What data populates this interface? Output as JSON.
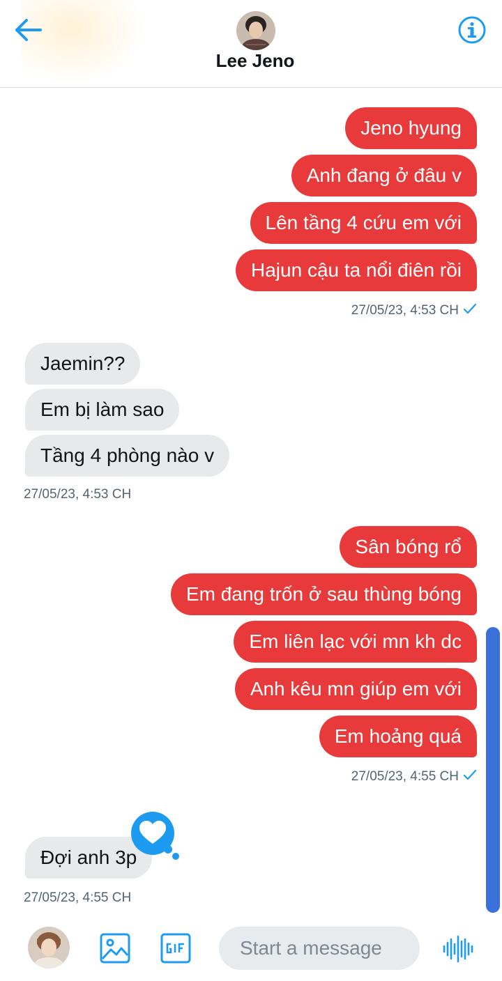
{
  "header": {
    "contact_name": "Lee Jeno"
  },
  "conversation": {
    "group1": {
      "messages": [
        "Jeno hyung",
        "Anh đang ở đâu v",
        "Lên tầng 4 cứu em với",
        "Hajun cậu ta nổi điên rồi"
      ],
      "timestamp": "27/05/23, 4:53 CH"
    },
    "group2": {
      "messages": [
        "Jaemin??",
        "Em bị làm sao",
        "Tầng 4 phòng nào v"
      ],
      "timestamp": "27/05/23, 4:53 CH"
    },
    "group3": {
      "messages": [
        "Sân bóng rổ",
        "Em đang trốn ở sau thùng bóng",
        "Em liên lạc với mn kh dc",
        "Anh kêu mn giúp em với",
        "Em hoảng quá"
      ],
      "timestamp": "27/05/23, 4:55 CH"
    },
    "group4": {
      "messages": [
        "Đợi anh 3p"
      ],
      "timestamp": "27/05/23, 4:55 CH"
    }
  },
  "composer": {
    "placeholder": "Start a message"
  },
  "colors": {
    "sent_bubble": "#e83a3a",
    "received_bubble": "#e7e9eb",
    "accent": "#1d9bf0",
    "scrollbar": "#3b6fd9"
  },
  "icons": [
    "back-arrow-icon",
    "info-icon",
    "heart-reaction-icon",
    "read-check-icon",
    "image-icon",
    "gif-icon",
    "voice-icon"
  ]
}
